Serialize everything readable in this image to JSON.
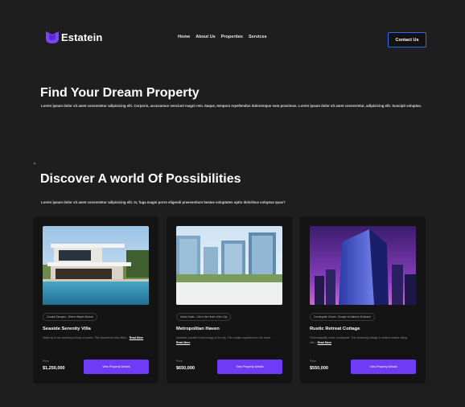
{
  "brand": {
    "name": "Estatein",
    "accent": "#703bf7"
  },
  "nav": {
    "items": [
      "Home",
      "About Us",
      "Properties",
      "Services"
    ]
  },
  "contact_button": "Contact Us",
  "hero": {
    "title": "Find Your Dream Property",
    "subtitle": "Lorem ipsum dolor sit amet consectetur adipisicing elit. Corporis, accusamus nesciunt magni rem. Itaque, tempora repellendus doloremque eum possimus. Lorem ipsum dolor sit amet consectetur, adipisicing elit. Suscipit voluptas."
  },
  "section": {
    "title": "Discover A world Of Possibilities",
    "subtitle": "Lorem ipsum dolor sit amet consectetur adipisicing elit. In, fuga magni porro eligendi praesentium beatae voluptates optio doloribus voluptas quas?"
  },
  "cards": [
    {
      "tag": "Coastal Escapes - Where Waves Beckon",
      "title": "Seaside Serenity Villa",
      "desc": "Wake up to the soothing melody of waves. This beachfront villa offers...",
      "read_more": "Read More",
      "price_label": "Price",
      "price": "$1,250,000",
      "button": "View Property Details"
    },
    {
      "tag": "Urban Oasis - Life in the Heart of the City",
      "title": "Metropolitan Haven",
      "desc": "Immerse yourself in the energy of the city. This modern apartment in the heart...",
      "read_more": "Read More",
      "price_label": "Price",
      "price": "$650,000",
      "button": "View Property Details"
    },
    {
      "tag": "Countryside Charm - Escape to Nature's Embrace",
      "title": "Rustic Retreat Cottage",
      "desc": "Find tranquility in the countryside. This charming cottage is nestled amidst rolling hills...",
      "read_more": "Read More",
      "price_label": "Price",
      "price": "$550,000",
      "button": "View Property Details"
    }
  ]
}
